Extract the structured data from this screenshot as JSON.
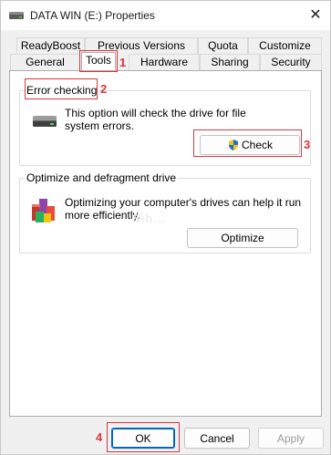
{
  "window": {
    "title": "DATA WIN (E:) Properties",
    "close_glyph": "✕",
    "icon": "drive-title-icon"
  },
  "tabs": {
    "row1": [
      "ReadyBoost",
      "Previous Versions",
      "Quota",
      "Customize"
    ],
    "row2": [
      "General",
      "Tools",
      "Hardware",
      "Sharing",
      "Security"
    ],
    "active": "Tools"
  },
  "error_checking": {
    "legend": "Error checking",
    "description_line1": "This option will check the drive for file",
    "description_line2": "system errors.",
    "button_label": "Check",
    "icon": "drive-icon",
    "button_icon": "uac-shield-icon"
  },
  "optimize": {
    "legend": "Optimize and defragment drive",
    "description_line1": "Optimizing your computer's drives can help it run",
    "description_line2": "more efficiently.",
    "button_label": "Optimize",
    "icon": "defrag-icon"
  },
  "footer": {
    "ok": "OK",
    "cancel": "Cancel",
    "apply": "Apply"
  },
  "annotations": {
    "n1": "1",
    "n2": "2",
    "n3": "3",
    "n4": "4",
    "color": "#d9363e"
  },
  "watermark": "Sih…"
}
